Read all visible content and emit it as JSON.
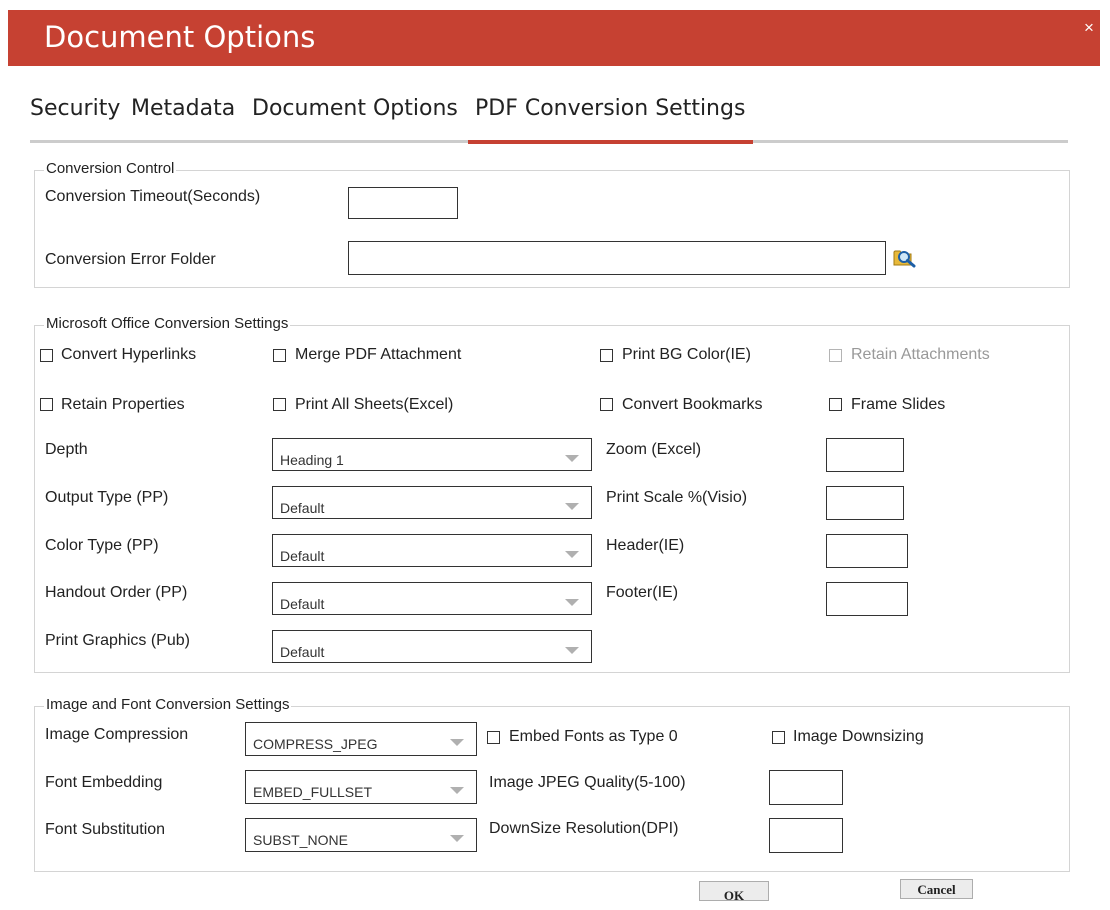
{
  "dialog": {
    "title": "Document Options",
    "close_label": "×"
  },
  "tabs": [
    {
      "label": "Security",
      "active": false
    },
    {
      "label": "Metadata",
      "active": false
    },
    {
      "label": "Document Options",
      "active": false
    },
    {
      "label": "PDF Conversion Settings",
      "active": true
    }
  ],
  "conversion_control": {
    "legend": "Conversion Control",
    "timeout_label": "Conversion Timeout(Seconds)",
    "timeout_value": "",
    "error_folder_label": "Conversion Error Folder",
    "error_folder_value": ""
  },
  "office": {
    "legend": "Microsoft Office Conversion Settings",
    "checkboxes": {
      "convert_hyperlinks": "Convert Hyperlinks",
      "merge_pdf_attachment": "Merge PDF Attachment",
      "print_bg_color": "Print BG Color(IE)",
      "retain_attachments": "Retain Attachments",
      "retain_properties": "Retain Properties",
      "print_all_sheets": "Print All Sheets(Excel)",
      "convert_bookmarks": "Convert Bookmarks",
      "frame_slides": "Frame Slides"
    },
    "depth_label": "Depth",
    "depth_value": "Heading 1",
    "output_type_label": "Output Type (PP)",
    "output_type_value": "Default",
    "color_type_label": "Color Type (PP)",
    "color_type_value": "Default",
    "handout_order_label": "Handout Order (PP)",
    "handout_order_value": "Default",
    "print_graphics_label": "Print Graphics (Pub)",
    "print_graphics_value": "Default",
    "zoom_label": "Zoom (Excel)",
    "print_scale_label": "Print Scale %(Visio)",
    "header_label": "Header(IE)",
    "footer_label": "Footer(IE)"
  },
  "image_font": {
    "legend": "Image and Font Conversion Settings",
    "image_compression_label": "Image Compression",
    "image_compression_value": "COMPRESS_JPEG",
    "font_embedding_label": "Font Embedding",
    "font_embedding_value": "EMBED_FULLSET",
    "font_substitution_label": "Font Substitution",
    "font_substitution_value": "SUBST_NONE",
    "embed_fonts_label": "Embed Fonts as Type 0",
    "image_downsizing_label": "Image Downsizing",
    "jpeg_quality_label": "Image JPEG Quality(5-100)",
    "downsize_resolution_label": "DownSize Resolution(DPI)"
  },
  "buttons": {
    "ok": "OK",
    "cancel": "Cancel"
  },
  "colors": {
    "accent": "#c64132",
    "tab_underline": "#cccccc"
  },
  "icons": {
    "browse": "folder-search-icon",
    "dropdown": "chevron-down-icon"
  }
}
